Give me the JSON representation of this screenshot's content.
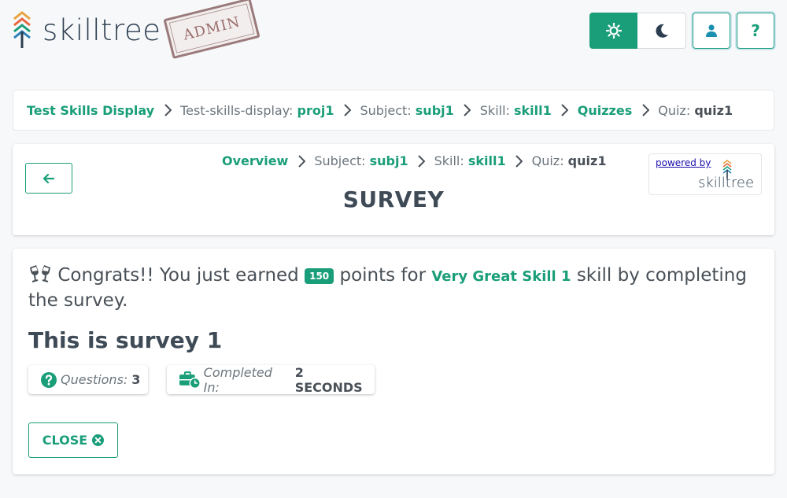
{
  "header": {
    "logo_text": "skilltree",
    "admin_stamp": "ADMIN",
    "help_label": "?",
    "icons": {
      "light": "sun-icon",
      "dark": "moon-icon",
      "user": "user-icon"
    }
  },
  "breadcrumb": {
    "root": "Test Skills Display",
    "project_label": "Test-skills-display:",
    "project_value": "proj1",
    "subject_label": "Subject:",
    "subject_value": "subj1",
    "skill_label": "Skill:",
    "skill_value": "skill1",
    "quizzes": "Quizzes",
    "quiz_label": "Quiz:",
    "quiz_value": "quiz1"
  },
  "title_card": {
    "overview": "Overview",
    "subject_label": "Subject:",
    "subject_value": "subj1",
    "skill_label": "Skill:",
    "skill_value": "skill1",
    "quiz_label": "Quiz:",
    "quiz_value": "quiz1",
    "title": "SURVEY",
    "powered_by": "powered by",
    "powered_logo": "skilltree"
  },
  "result": {
    "congrats_prefix": "Congrats!! You just earned",
    "points": "150",
    "points_for": "points for",
    "skill_name": "Very Great Skill 1",
    "congrats_suffix": "skill by completing the survey.",
    "survey_name": "This is survey 1",
    "questions_label": "Questions:",
    "questions_value": "3",
    "completed_label": "Completed In:",
    "completed_value": "2 SECONDS",
    "close_label": "CLOSE"
  },
  "colors": {
    "accent": "#1a9e79",
    "text": "#495057"
  }
}
